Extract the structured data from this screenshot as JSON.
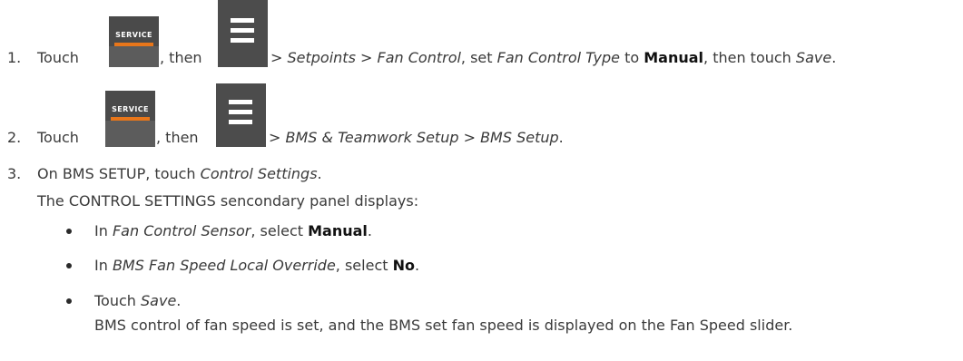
{
  "steps": [
    {
      "number": "1.",
      "touch": "Touch",
      "then": ", then",
      "path_sep1": " > ",
      "path_a": "Setpoints",
      "path_sep2": " > ",
      "path_b": "Fan Control",
      "set_text": ", set ",
      "field": "Fan Control Type",
      "to_text": " to ",
      "value": "Manual",
      "then_touch": ", then touch ",
      "action": "Save",
      "end": "."
    },
    {
      "number": "2.",
      "touch": "Touch",
      "then": ", then",
      "path_sep1": " > ",
      "path_a": "BMS & Teamwork Setup",
      "path_sep2": " > ",
      "path_b": "BMS Setup",
      "end": "."
    },
    {
      "number": "3.",
      "line1_a": "On BMS SETUP, touch ",
      "line1_b": "Control Settings",
      "line1_end": ".",
      "line2": "The CONTROL SETTINGS sencondary panel displays:",
      "bullets": [
        {
          "pre": "In ",
          "field": "Fan Control Sensor",
          "mid": ", select ",
          "value": "Manual",
          "end": "."
        },
        {
          "pre": "In ",
          "field": "BMS Fan Speed Local Override",
          "mid": ", select ",
          "value": "No",
          "end": "."
        },
        {
          "pre": "Touch ",
          "field": "Save",
          "end": "."
        }
      ],
      "result": "BMS control of fan speed is set, and the BMS set fan speed is displayed on the Fan Speed slider."
    }
  ],
  "icons": {
    "service_label": "SERVICE",
    "service_accent": "#e8761a",
    "menu_icon": "hamburger-menu-icon"
  }
}
